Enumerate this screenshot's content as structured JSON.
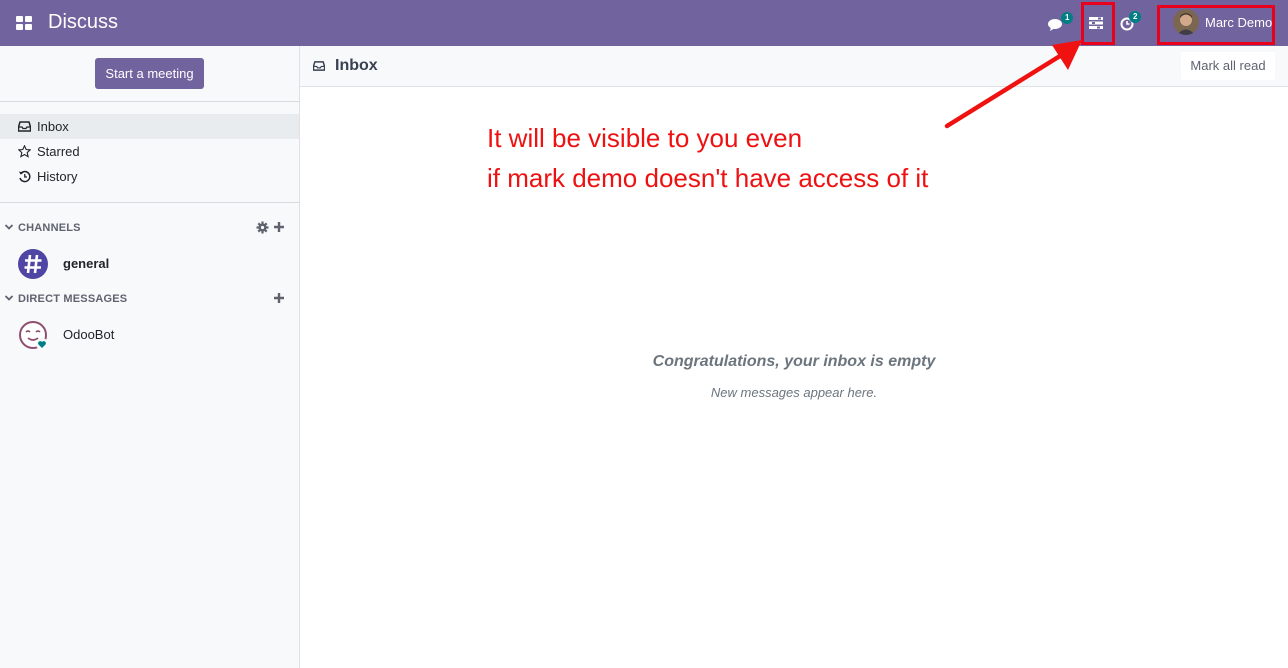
{
  "navbar": {
    "app_title": "Discuss",
    "messages_badge": "1",
    "activities_badge": "2",
    "user_name": "Marc Demo",
    "bg_color": "#71639e"
  },
  "sidebar": {
    "start_meeting_label": "Start a meeting",
    "mailboxes": [
      {
        "label": "Inbox",
        "icon": "inbox-icon",
        "active": true
      },
      {
        "label": "Starred",
        "icon": "star-icon",
        "active": false
      },
      {
        "label": "History",
        "icon": "history-icon",
        "active": false
      }
    ],
    "channels_header": "CHANNELS",
    "channels": [
      {
        "label": "general",
        "icon": "hashtag-avatar"
      }
    ],
    "dm_header": "DIRECT MESSAGES",
    "direct_messages": [
      {
        "label": "OdooBot",
        "icon": "odoobot-avatar"
      }
    ]
  },
  "main": {
    "title": "Inbox",
    "mark_all_read_label": "Mark all read",
    "empty_title": "Congratulations, your inbox is empty",
    "empty_subtitle": "New messages appear here."
  },
  "annotation": {
    "line1": "It will be visible to you even",
    "line2": "if mark demo doesn't have access of it",
    "color": "#ee1111"
  }
}
